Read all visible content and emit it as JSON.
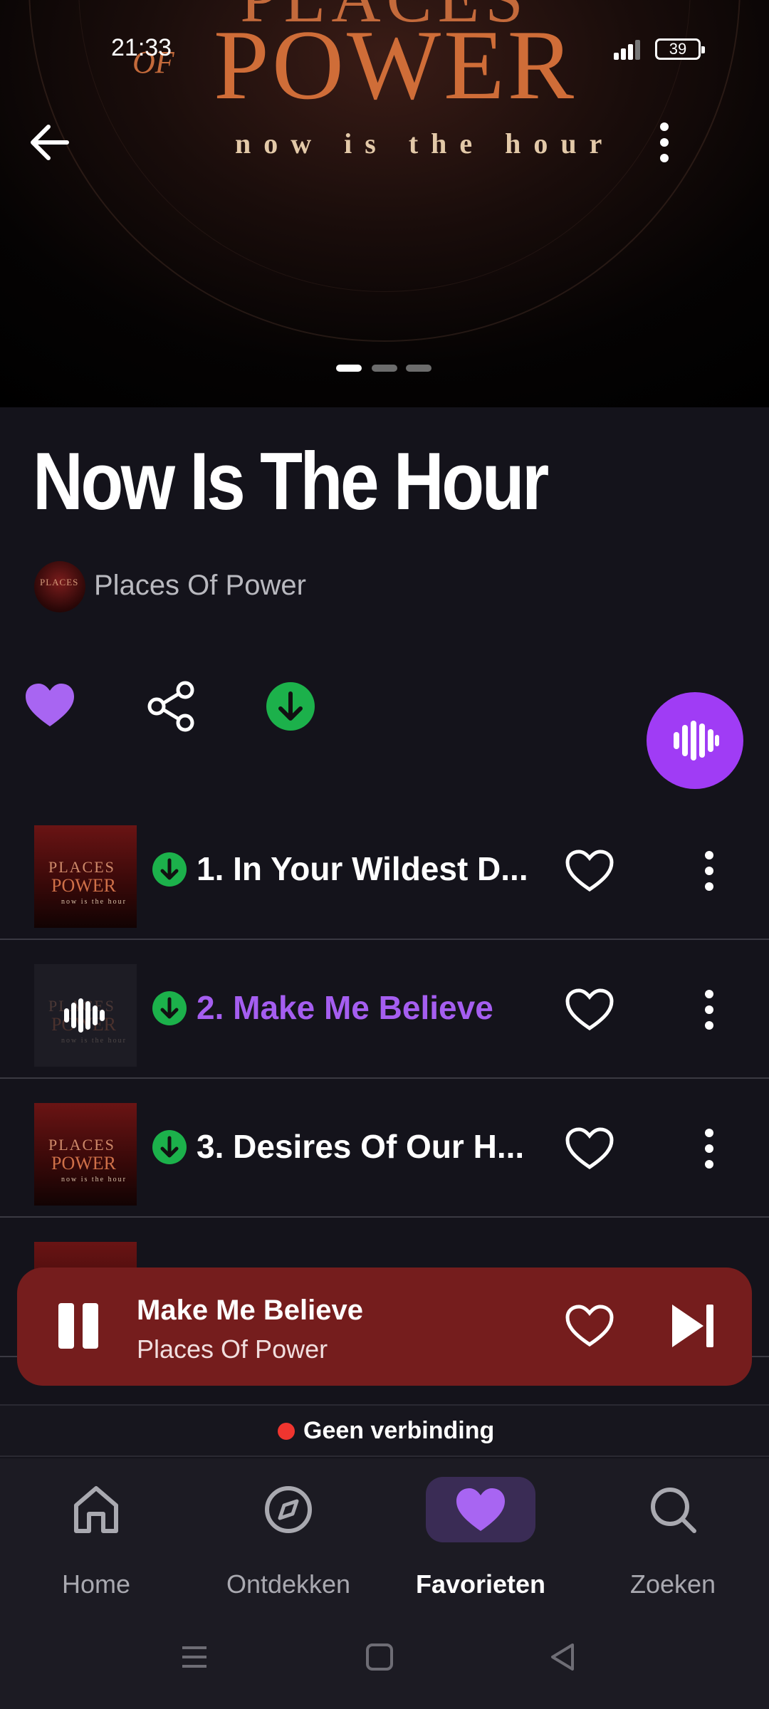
{
  "status_bar": {
    "time": "21:33",
    "battery": "39"
  },
  "cover": {
    "logo_top": "PLACES",
    "logo_of": "OF",
    "logo_power": "POWER",
    "tagline": "now is the hour"
  },
  "album": {
    "title": "Now Is The Hour",
    "artist": "Places Of Power"
  },
  "cover_art_text": {
    "line1": "PLACES",
    "line2": "POWER",
    "line3": "now is the hour"
  },
  "tracks": [
    {
      "title": "1. In Your Wildest D...",
      "active": false
    },
    {
      "title": "2. Make Me Believe",
      "active": true
    },
    {
      "title": "3. Desires Of Our H...",
      "active": false
    }
  ],
  "now_playing": {
    "title": "Make Me Believe",
    "artist": "Places Of Power"
  },
  "offline": {
    "message": "Geen verbinding"
  },
  "nav": {
    "home": "Home",
    "discover": "Ontdekken",
    "favorites": "Favorieten",
    "search": "Zoeken"
  },
  "colors": {
    "accent": "#a03cf5",
    "download_green": "#1cb14b",
    "player_bg": "#751d1d",
    "active_track": "#a55ef0",
    "offline_dot": "#f0352f"
  },
  "icons": [
    "back-arrow-icon",
    "more-vertical-icon",
    "heart-icon",
    "share-icon",
    "download-icon",
    "waveform-icon",
    "pause-icon",
    "skip-next-icon",
    "home-icon",
    "compass-icon",
    "search-icon"
  ]
}
